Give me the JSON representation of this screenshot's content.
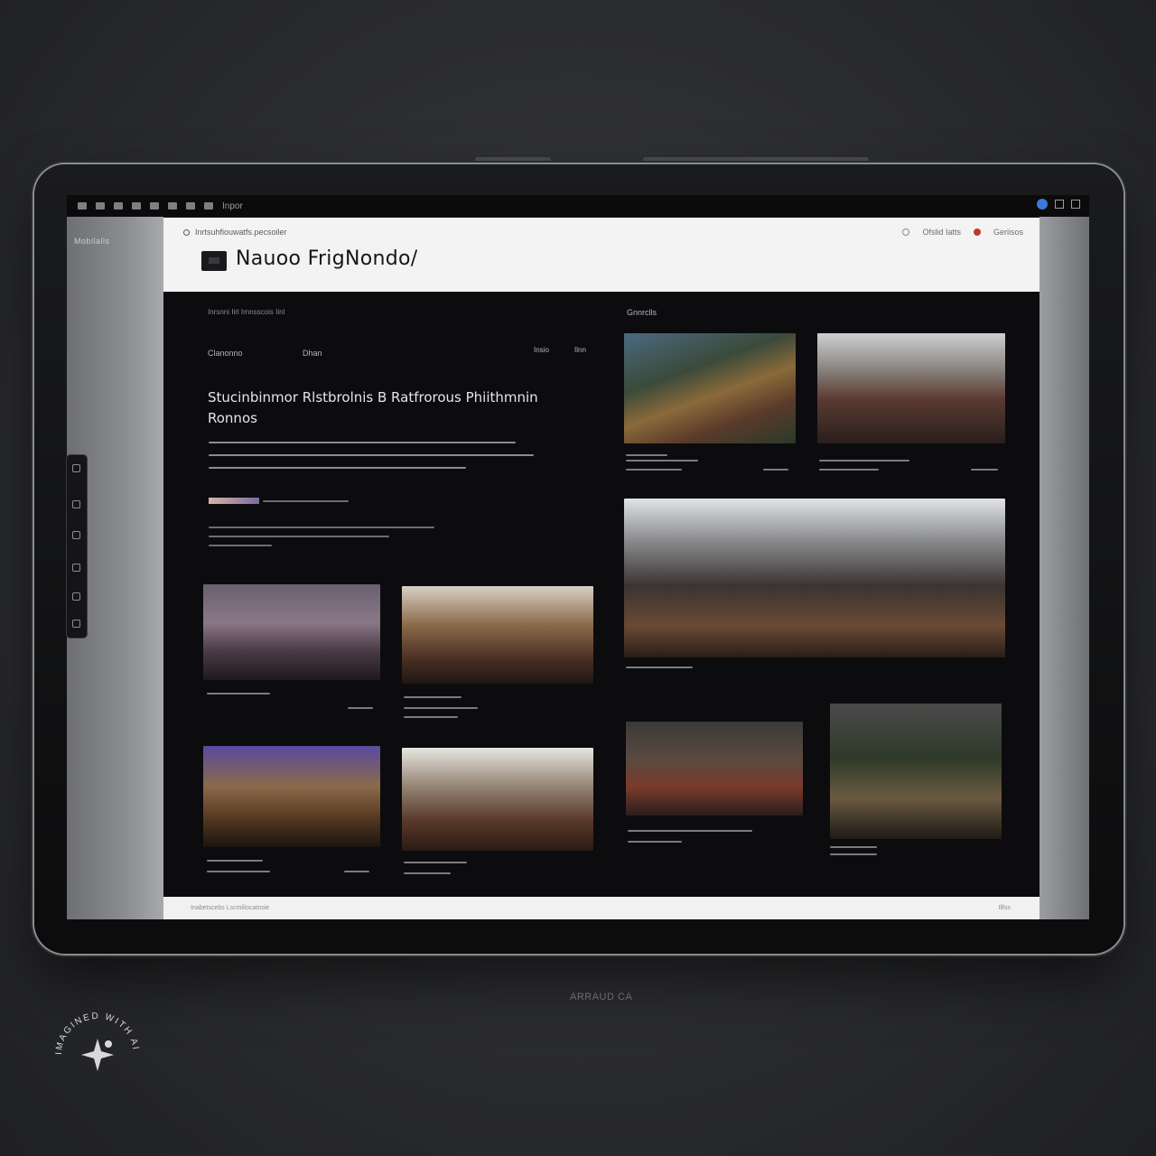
{
  "statusbar": {
    "center_text": "Inpor"
  },
  "side_left_label": "Mobilalls",
  "browser": {
    "url": "Inrtsuhfiouwatfs.pecsoiler",
    "site_title": "Nauoo FrigNondo/",
    "header_links": [
      "Ofslid Iatts",
      "Geriisos"
    ],
    "footer_left": "Inabetscebs Lscmiliocatnsie",
    "footer_right": "Illlss"
  },
  "content": {
    "breadcrumb": "Inrsnni Iirl Irnnsscois Iinl",
    "filters": {
      "left": "Clanonno",
      "middle": "Dhan",
      "right1": "Insio",
      "right2": "Ilnn"
    },
    "hero_title": "Stucinbinmor Rlstbrolnis B Ratfrorous Phiithmnin Ronnos",
    "gallery_label": "Gnnrclls"
  },
  "caption": "ARRAUD CA",
  "watermark_text": "IMAGINED WITH AI",
  "colors": {
    "accent_start": "#d8b4a8",
    "accent_end": "#7a6c9e",
    "header_bg": "#f3f3f4",
    "content_bg": "#0c0c0e"
  }
}
